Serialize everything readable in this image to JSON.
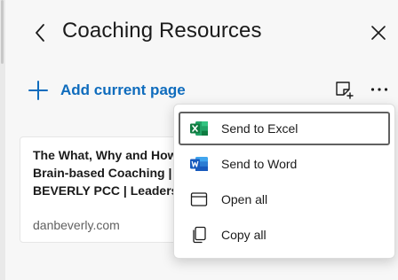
{
  "header": {
    "title": "Coaching Resources",
    "back_icon": "back-chevron-icon",
    "close_icon": "close-icon"
  },
  "toolbar": {
    "add_page_label": "Add current page",
    "add_icon": "plus-icon",
    "note_icon": "add-note-icon",
    "more_icon": "more-options-icon",
    "accent_color": "#0f6cbd"
  },
  "card": {
    "title": "The What, Why and How of\nBrain-based Coaching | DAN\nBEVERLY PCC | Leadership",
    "domain": "danbeverly.com"
  },
  "menu": {
    "items": [
      {
        "label": "Send to Excel",
        "icon": "excel-icon",
        "color": "#107c41"
      },
      {
        "label": "Send to Word",
        "icon": "word-icon",
        "color": "#185abd"
      },
      {
        "label": "Open all",
        "icon": "window-icon"
      },
      {
        "label": "Copy all",
        "icon": "copy-icon"
      }
    ]
  }
}
